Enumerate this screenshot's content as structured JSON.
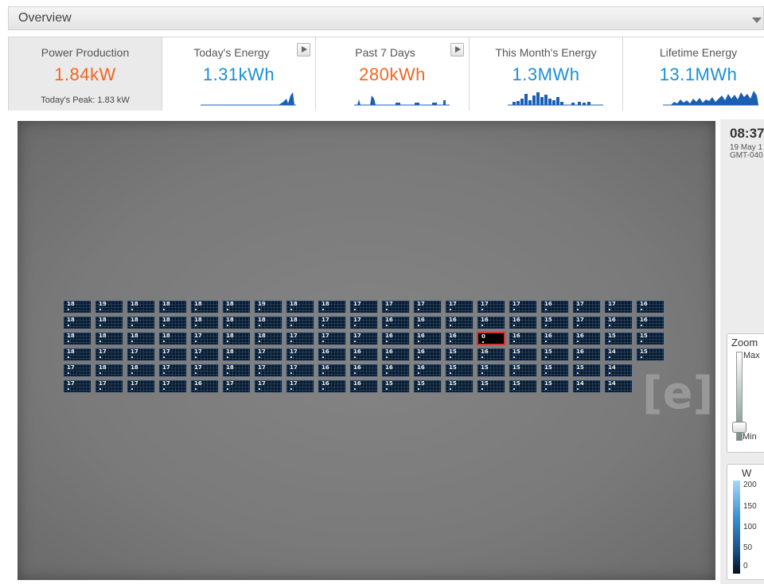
{
  "header": {
    "title": "Overview"
  },
  "stats": [
    {
      "label": "Power Production",
      "value": "1.84kW",
      "sub": "Today's Peak: 1.83 kW",
      "color": "#f26522",
      "play": false
    },
    {
      "label": "Today's Energy",
      "value": "1.31kWh",
      "color": "#1a8fd6",
      "play": true
    },
    {
      "label": "Past 7 Days",
      "value": "280kWh",
      "color": "#f26522",
      "play": true
    },
    {
      "label": "This Month's Energy",
      "value": "1.3MWh",
      "color": "#1a8fd6",
      "play": false
    },
    {
      "label": "Lifetime Energy",
      "value": "13.1MWh",
      "color": "#1a8fd6",
      "play": false
    }
  ],
  "array": {
    "rows": [
      [
        "18",
        "19",
        "18",
        "18",
        "18",
        "18",
        "19",
        "18",
        "18",
        "17",
        "17",
        "17",
        "17",
        "17",
        "17",
        "16",
        "17",
        "17",
        "16"
      ],
      [
        "18",
        "18",
        "18",
        "18",
        "18",
        "18",
        "18",
        "18",
        "17",
        "17",
        "16",
        "16",
        "16",
        "16",
        "16",
        "15",
        "17",
        "16",
        "16"
      ],
      [
        "18",
        "18",
        "18",
        "18",
        "17",
        "18",
        "18",
        "17",
        "17",
        "17",
        "16",
        "16",
        "16",
        "0",
        "16",
        "16",
        "16",
        "15",
        "15"
      ],
      [
        "18",
        "17",
        "17",
        "17",
        "17",
        "18",
        "17",
        "17",
        "16",
        "16",
        "16",
        "16",
        "15",
        "16",
        "15",
        "15",
        "16",
        "14",
        "15"
      ],
      [
        "17",
        "18",
        "18",
        "17",
        "17",
        "18",
        "17",
        "17",
        "16",
        "16",
        "16",
        "16",
        "15",
        "15",
        "15",
        "15",
        "15",
        "14"
      ],
      [
        "17",
        "17",
        "17",
        "17",
        "16",
        "17",
        "17",
        "17",
        "16",
        "16",
        "15",
        "15",
        "15",
        "15",
        "15",
        "15",
        "14",
        "14"
      ]
    ],
    "selected_label": "0"
  },
  "clock": {
    "time": "08:37",
    "date": "19 May 1",
    "tz": "GMT-040"
  },
  "zoom": {
    "label": "Zoom",
    "max": "Max",
    "min": "Min",
    "level": 0.05
  },
  "legend": {
    "unit": "W",
    "ticks": [
      "200",
      "150",
      "100",
      "50",
      "0"
    ]
  },
  "watermark": "[e]"
}
